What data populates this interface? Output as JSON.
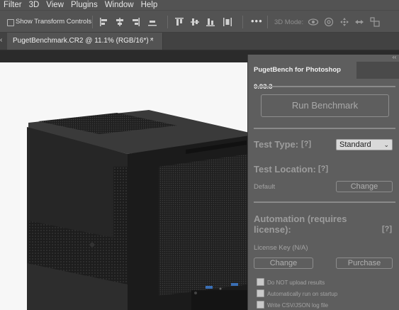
{
  "menu": [
    "Filter",
    "3D",
    "View",
    "Plugins",
    "Window",
    "Help"
  ],
  "options_bar": {
    "show_transform_controls": "Show Transform Controls",
    "more": "•••",
    "mode_label": "3D Mode:"
  },
  "document_tab": {
    "title": "PugetBenchmark.CR2 @ 11.1% (RGB/16*) *",
    "close": "×"
  },
  "panel": {
    "tab_title": "PugetBench for Photoshop 0.93.3",
    "run_benchmark": "Run Benchmark",
    "test_type_label": "Test Type:",
    "test_type_help": "[?]",
    "test_type_value": "Standard",
    "test_location_label": "Test Location:",
    "test_location_help": "[?]",
    "test_location_value": "Default",
    "change": "Change",
    "automation_label": "Automation (requires license):",
    "automation_help": "[?]",
    "license_key": "License Key (N/A)",
    "purchase": "Purchase",
    "checkboxes": [
      "Do NOT upload results",
      "Automatically run on startup",
      "Write CSV/JSON log file"
    ]
  },
  "colors": {
    "ui_gray": "#535353",
    "panel_bg": "#5e5e5e",
    "canvas_bg": "#2b2b2b"
  }
}
